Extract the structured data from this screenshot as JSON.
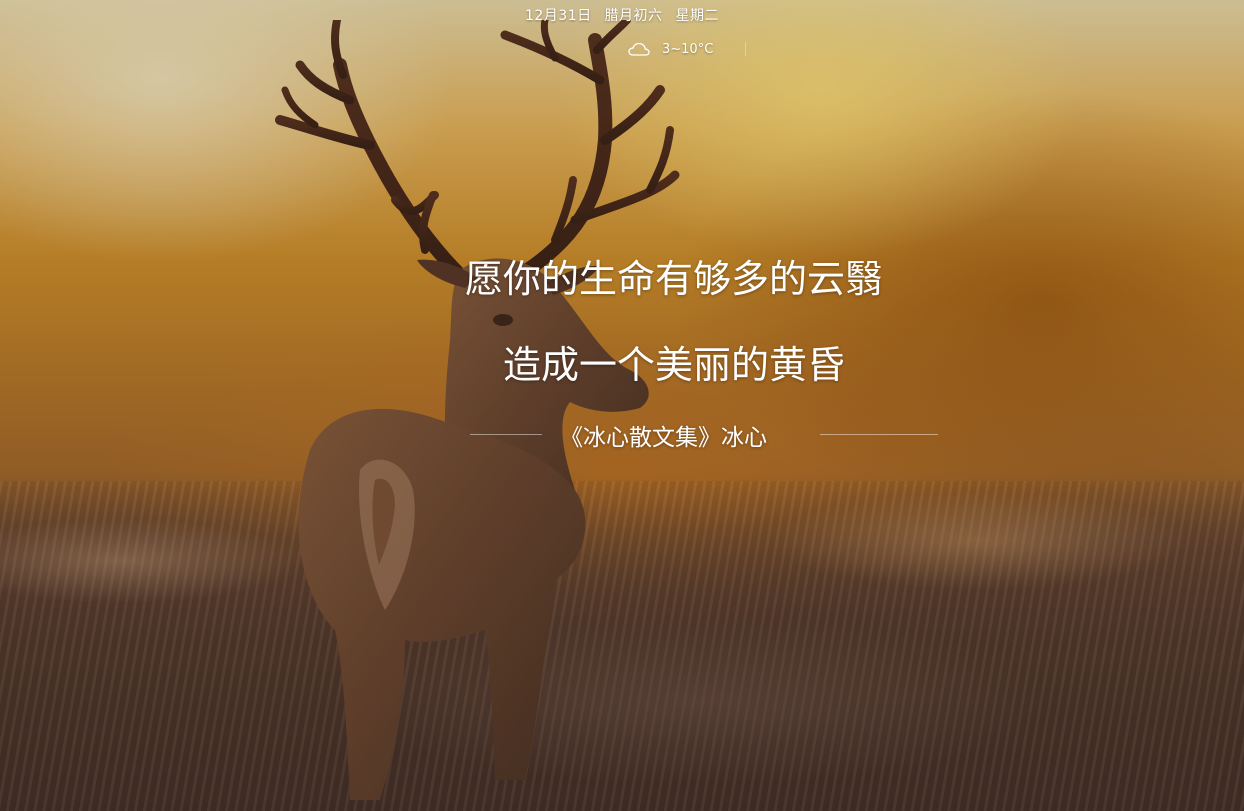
{
  "header": {
    "date": "12月31日",
    "lunar_date": "腊月初六",
    "weekday": "星期二",
    "weather_icon": "cloud-icon",
    "temperature": "3~10°C"
  },
  "quote": {
    "line1": "愿你的生命有够多的云翳",
    "line2": "造成一个美丽的黄昏",
    "source": "《冰心散文集》冰心"
  },
  "colors": {
    "text": "#ffffff",
    "sky_light": "#e9d8a8",
    "gold": "#e5b35a",
    "deer_brown": "#6a4630",
    "ground": "#463226"
  }
}
